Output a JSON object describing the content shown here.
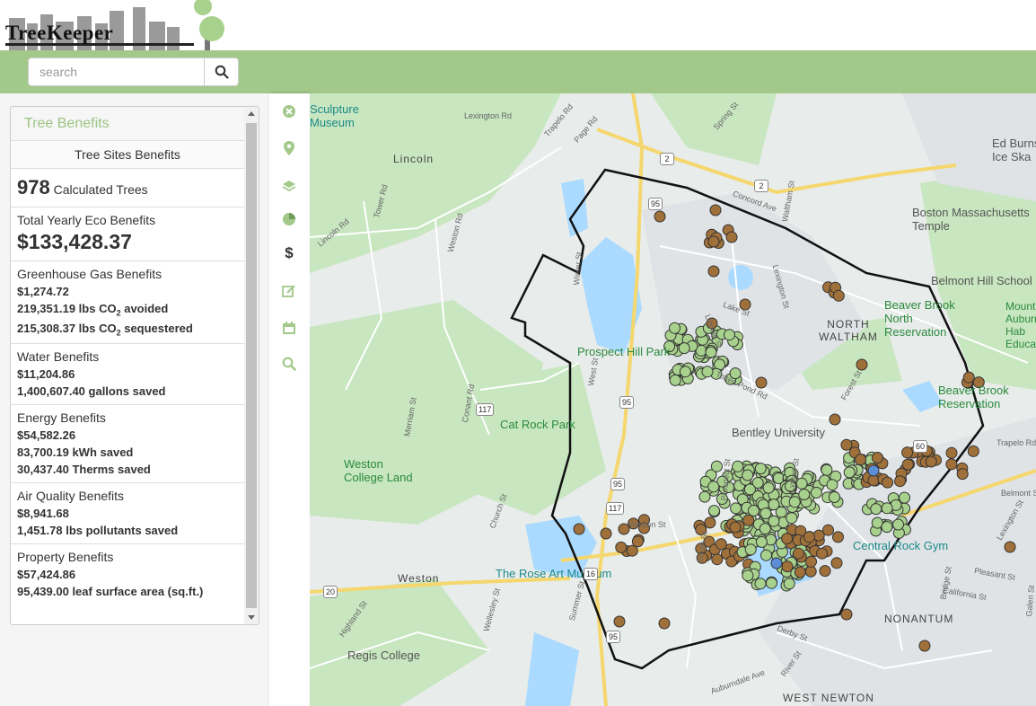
{
  "header": {
    "logo_text": "TreeKeeper"
  },
  "search": {
    "placeholder": "search"
  },
  "tools": [
    "close-icon",
    "map-marker-icon",
    "layers-icon",
    "pie-chart-icon",
    "dollar-icon",
    "edit-icon",
    "calendar-icon",
    "search-icon"
  ],
  "panel": {
    "title": "Tree Benefits",
    "sites_header": "Tree Sites Benefits",
    "calculated_count": "978",
    "calculated_label": "Calculated Trees",
    "eco_label": "Total Yearly Eco Benefits",
    "eco_value": "$133,428.37",
    "ghg_label": "Greenhouse Gas Benefits",
    "ghg_value": "$1,274.72",
    "ghg_avoided_num": "219,351.19 lbs CO",
    "ghg_avoided_sub": "2",
    "ghg_avoided_tail": "avoided",
    "ghg_seq_num": "215,308.37 lbs CO",
    "ghg_seq_sub": "2",
    "ghg_seq_tail": "sequestered",
    "water_label": "Water Benefits",
    "water_value": "$11,204.86",
    "water_gallons": "1,400,607.40 gallons saved",
    "energy_label": "Energy Benefits",
    "energy_value": "$54,582.26",
    "energy_kwh": "83,700.19 kWh saved",
    "energy_therms": "30,437.40 Therms saved",
    "air_label": "Air Quality Benefits",
    "air_value": "$8,941.68",
    "air_pollutants": "1,451.78 lbs pollutants saved",
    "property_label": "Property Benefits",
    "property_value": "$57,424.86",
    "property_leaf": "95,439.00 leaf surface area (sq.ft.)"
  },
  "map": {
    "towns": [
      "Lincoln",
      "NORTH WALTHAM",
      "Weston",
      "NONANTUM",
      "WEST NEWTON",
      "Belmont Hill School",
      "Boston Massachusetts Temple",
      "Ed Burns Ice Ska"
    ],
    "pois": [
      "Sculpture Museum",
      "Prospect Hill Park",
      "Cat Rock Park",
      "Weston College Land",
      "Bentley University",
      "Central Rock Gym",
      "The Rose Art Museum",
      "Regis College",
      "Beaver Brook North Reservation",
      "Beaver Brook Reservation",
      "Mount Auburn Hab Educa"
    ],
    "roads": [
      "Lexington Rd",
      "Trapelo Rd",
      "Page Rd",
      "Spring St",
      "Concord Ave",
      "Waltham St",
      "Lincoln Rd",
      "Tower Rd",
      "Weston Rd",
      "Winter St",
      "Lake St",
      "Lexington St",
      "Lincoln St",
      "Totten Pond Rd",
      "Forest St",
      "West St",
      "Merriam St",
      "Conant Rd",
      "Church St",
      "Prospect St",
      "South St",
      "Lyman St",
      "Weston St",
      "Wellesley St",
      "Summer St",
      "Highland St",
      "River St",
      "Auburndale Ave",
      "Derby St",
      "Bridge St",
      "California St",
      "Pleasant St",
      "Galen St",
      "Belmont St",
      "Lexington St",
      "Trapelo Rd"
    ],
    "shields": [
      "2",
      "2",
      "95",
      "95",
      "95",
      "117",
      "117",
      "60",
      "20",
      "20",
      "16",
      "95"
    ],
    "colors": {
      "tree_green": "#a8d18d",
      "tree_brown": "#a0703a",
      "tree_blue": "#5b8ed6",
      "boundary": "#111111",
      "water": "#aadaff",
      "park": "#c8e6c0"
    }
  }
}
